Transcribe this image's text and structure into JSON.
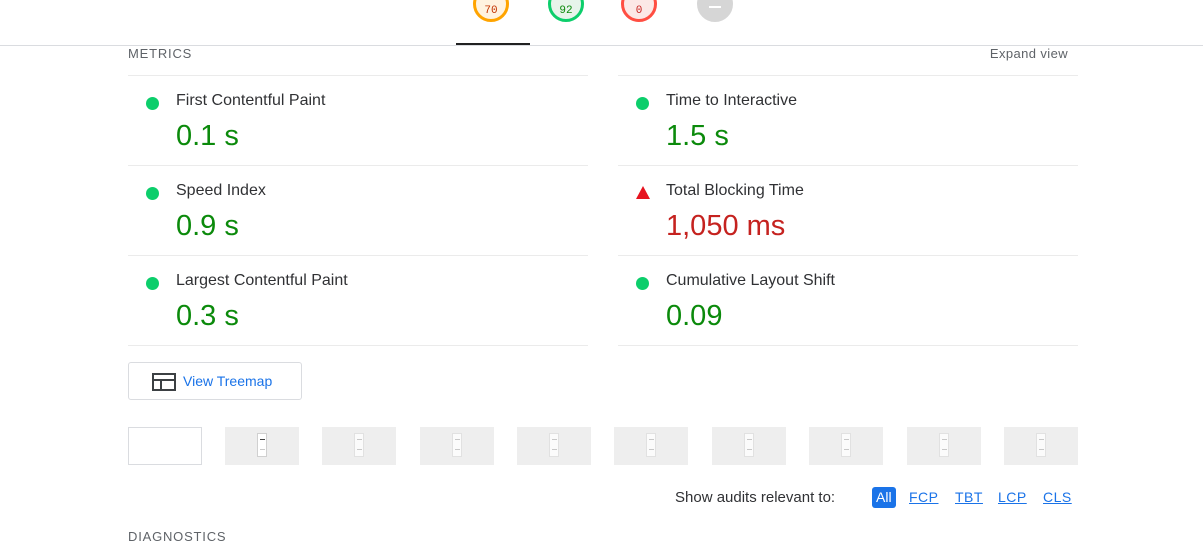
{
  "score_tabs": [
    {
      "value": "70",
      "status": "average",
      "color": "#ffa400"
    },
    {
      "value": "92",
      "status": "pass",
      "color": "#0cce6b"
    },
    {
      "value": "0",
      "status": "fail",
      "color": "#ff4e42"
    },
    {
      "value": "",
      "status": "not-applicable",
      "color": "#d6d6d6"
    }
  ],
  "metrics_section": {
    "title": "METRICS",
    "expand_label": "Expand view"
  },
  "metrics": [
    {
      "label": "First Contentful Paint",
      "value": "0.1 s",
      "status": "pass"
    },
    {
      "label": "Time to Interactive",
      "value": "1.5 s",
      "status": "pass"
    },
    {
      "label": "Speed Index",
      "value": "0.9 s",
      "status": "pass"
    },
    {
      "label": "Total Blocking Time",
      "value": "1,050 ms",
      "status": "fail"
    },
    {
      "label": "Largest Contentful Paint",
      "value": "0.3 s",
      "status": "pass"
    },
    {
      "label": "Cumulative Layout Shift",
      "value": "0.09",
      "status": "pass"
    }
  ],
  "treemap_button": {
    "label": "View Treemap",
    "icon": "treemap-icon"
  },
  "filmstrip": {
    "frame_count": 10
  },
  "audit_filter": {
    "label": "Show audits relevant to:",
    "options": [
      "All",
      "FCP",
      "TBT",
      "LCP",
      "CLS"
    ],
    "selected": "All"
  },
  "diagnostics_section": {
    "title": "DIAGNOSTICS"
  },
  "colors": {
    "pass": "#0cce6b",
    "pass_text": "#0b8a0b",
    "fail": "#e6131f",
    "fail_text": "#c5221f",
    "accent": "#1a73e8"
  }
}
